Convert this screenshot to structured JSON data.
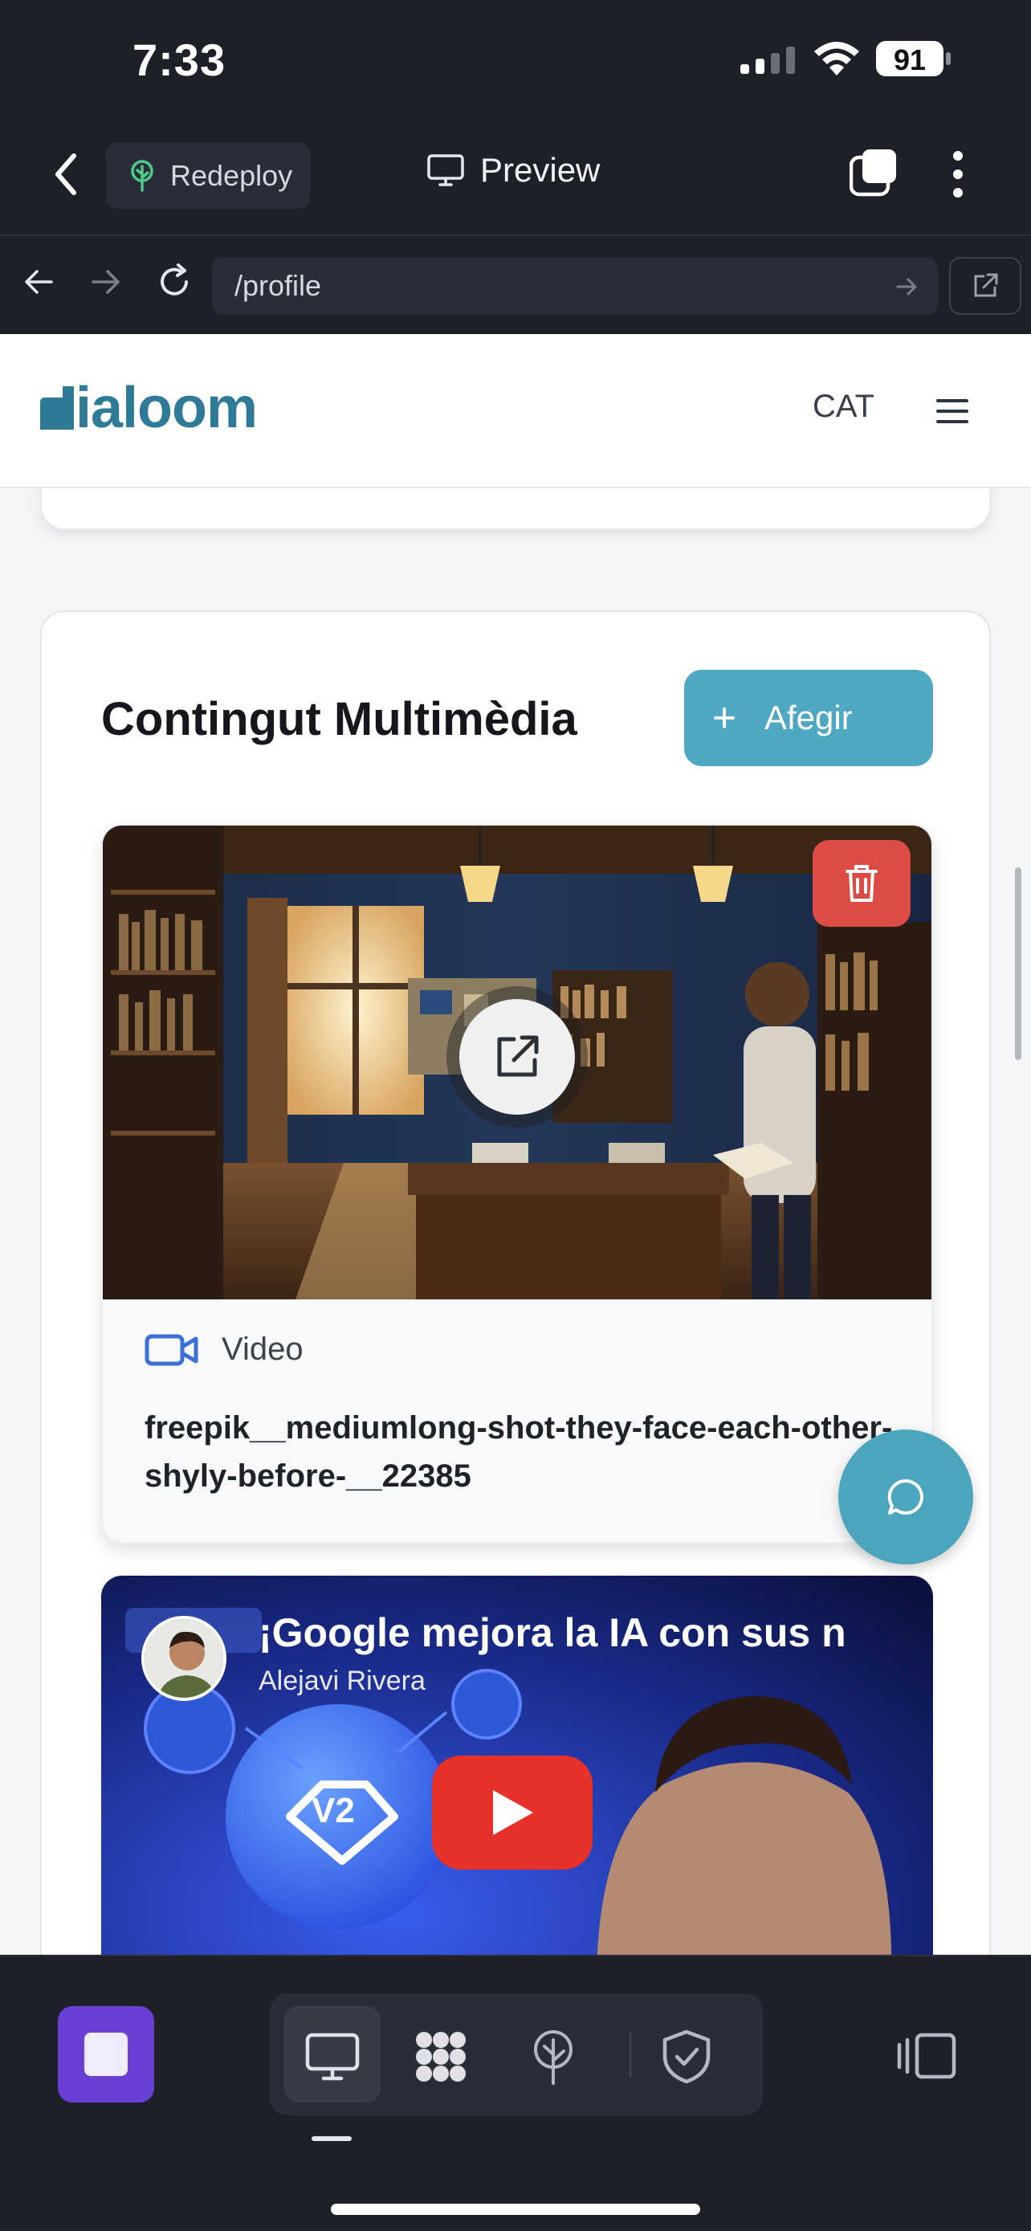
{
  "status_bar": {
    "time": "7:33",
    "battery": "91"
  },
  "toolbar": {
    "redeploy_label": "Redeploy",
    "preview_label": "Preview"
  },
  "address_bar": {
    "url": "/profile"
  },
  "site": {
    "logo_text": "ialoom",
    "language": "CAT",
    "colors": {
      "brand": "#2f7a97",
      "accent": "#4fa8c1",
      "delete": "#dc4b45"
    }
  },
  "media_section": {
    "title": "Contingut Multimèdia",
    "add_label": "Afegir",
    "items": [
      {
        "type_label": "Video",
        "file_name": "freepik__mediumlong-shot-they-face-each-other-shyly-before-__22385"
      }
    ],
    "youtube": {
      "title": "¡Google mejora la IA con sus n",
      "channel": "Alejavi Rivera",
      "badge": "V2"
    }
  },
  "dock": {
    "icons": [
      "monitor-icon",
      "apps-grid-icon",
      "deploy-tree-icon",
      "shield-check-icon"
    ]
  }
}
